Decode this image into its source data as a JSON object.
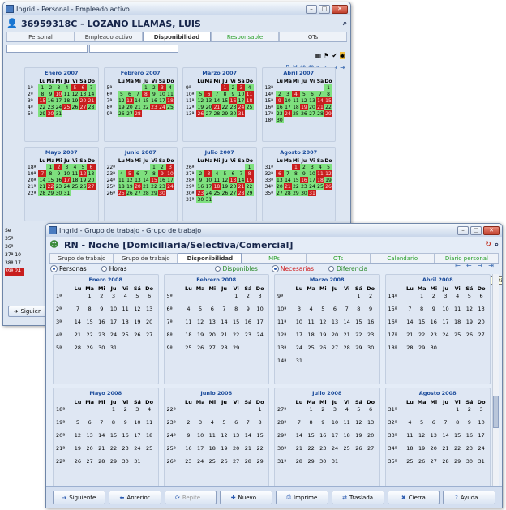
{
  "back": {
    "title": "Ingrid - Personal - Empleado activo",
    "header": "36959318C - LOZANO LLAMAS, LUIS",
    "tabs": [
      {
        "label": "Personal"
      },
      {
        "label": "Empleado activo"
      },
      {
        "label": "Disponibilidad"
      },
      {
        "label": "Responsable"
      },
      {
        "label": "OTs"
      }
    ],
    "side_weeks": [
      "Se",
      "35ª",
      "36ª",
      "37ª 10",
      "38ª 17",
      "39ª 24"
    ],
    "footer_btn": "Siguien",
    "months": [
      {
        "name": "Enero 2007",
        "rows": [
          [
            "1ª",
            "1",
            "2",
            "3",
            "4",
            "5",
            "6",
            "7"
          ],
          [
            "2ª",
            "8",
            "9",
            "10",
            "11",
            "12",
            "13",
            "14"
          ],
          [
            "3ª",
            "15",
            "16",
            "17",
            "18",
            "19",
            "20",
            "21"
          ],
          [
            "4ª",
            "22",
            "23",
            "24",
            "25",
            "26",
            "27",
            "28"
          ],
          [
            "5ª",
            "29",
            "30",
            "31",
            "",
            "",
            "",
            ""
          ]
        ]
      },
      {
        "name": "Febrero 2007",
        "rows": [
          [
            "5ª",
            "",
            "",
            "",
            "1",
            "2",
            "3",
            "4"
          ],
          [
            "6ª",
            "5",
            "6",
            "7",
            "8",
            "9",
            "10",
            "11"
          ],
          [
            "7ª",
            "12",
            "13",
            "14",
            "15",
            "16",
            "17",
            "18"
          ],
          [
            "8ª",
            "19",
            "20",
            "21",
            "22",
            "23",
            "24",
            "25"
          ],
          [
            "9ª",
            "26",
            "27",
            "28",
            "",
            "",
            "",
            ""
          ]
        ]
      },
      {
        "name": "Marzo 2007",
        "rows": [
          [
            "9ª",
            "",
            "",
            "",
            "1",
            "2",
            "3",
            "4"
          ],
          [
            "10ª",
            "5",
            "6",
            "7",
            "8",
            "9",
            "10",
            "11"
          ],
          [
            "11ª",
            "12",
            "13",
            "14",
            "15",
            "16",
            "17",
            "18"
          ],
          [
            "12ª",
            "19",
            "20",
            "21",
            "22",
            "23",
            "24",
            "25"
          ],
          [
            "13ª",
            "26",
            "27",
            "28",
            "29",
            "30",
            "31",
            ""
          ]
        ]
      },
      {
        "name": "Abril 2007",
        "rows": [
          [
            "13ª",
            "",
            "",
            "",
            "",
            "",
            "",
            "1"
          ],
          [
            "14ª",
            "2",
            "3",
            "4",
            "5",
            "6",
            "7",
            "8"
          ],
          [
            "15ª",
            "9",
            "10",
            "11",
            "12",
            "13",
            "14",
            "15"
          ],
          [
            "16ª",
            "16",
            "17",
            "18",
            "19",
            "20",
            "21",
            "22"
          ],
          [
            "17ª",
            "23",
            "24",
            "25",
            "26",
            "27",
            "28",
            "29"
          ],
          [
            "18ª",
            "30",
            "",
            "",
            "",
            "",
            "",
            ""
          ]
        ]
      },
      {
        "name": "Mayo 2007",
        "rows": [
          [
            "18ª",
            "",
            "1",
            "2",
            "3",
            "4",
            "5",
            "6"
          ],
          [
            "19ª",
            "7",
            "8",
            "9",
            "10",
            "11",
            "12",
            "13"
          ],
          [
            "20ª",
            "14",
            "15",
            "16",
            "17",
            "18",
            "19",
            "20"
          ],
          [
            "21ª",
            "21",
            "22",
            "23",
            "24",
            "25",
            "26",
            "27"
          ],
          [
            "22ª",
            "28",
            "29",
            "30",
            "31",
            "",
            "",
            ""
          ]
        ]
      },
      {
        "name": "Junio 2007",
        "rows": [
          [
            "22ª",
            "",
            "",
            "",
            "",
            "1",
            "2",
            "3"
          ],
          [
            "23ª",
            "4",
            "5",
            "6",
            "7",
            "8",
            "9",
            "10"
          ],
          [
            "24ª",
            "11",
            "12",
            "13",
            "14",
            "15",
            "16",
            "17"
          ],
          [
            "25ª",
            "18",
            "19",
            "20",
            "21",
            "22",
            "23",
            "24"
          ],
          [
            "26ª",
            "25",
            "26",
            "27",
            "28",
            "29",
            "30",
            ""
          ]
        ]
      },
      {
        "name": "Julio 2007",
        "rows": [
          [
            "26ª",
            "",
            "",
            "",
            "",
            "",
            "",
            "1"
          ],
          [
            "27ª",
            "2",
            "3",
            "4",
            "5",
            "6",
            "7",
            "8"
          ],
          [
            "28ª",
            "9",
            "10",
            "11",
            "12",
            "13",
            "14",
            "15"
          ],
          [
            "29ª",
            "16",
            "17",
            "18",
            "19",
            "20",
            "21",
            "22"
          ],
          [
            "30ª",
            "23",
            "24",
            "25",
            "26",
            "27",
            "28",
            "29"
          ],
          [
            "31ª",
            "30",
            "31",
            "",
            "",
            "",
            "",
            ""
          ]
        ]
      },
      {
        "name": "Agosto 2007",
        "rows": [
          [
            "31ª",
            "",
            "",
            "1",
            "2",
            "3",
            "4",
            "5"
          ],
          [
            "32ª",
            "6",
            "7",
            "8",
            "9",
            "10",
            "11",
            "12"
          ],
          [
            "33ª",
            "13",
            "14",
            "15",
            "16",
            "17",
            "18",
            "19"
          ],
          [
            "34ª",
            "20",
            "21",
            "22",
            "23",
            "24",
            "25",
            "26"
          ],
          [
            "35ª",
            "27",
            "28",
            "29",
            "30",
            "31",
            "",
            ""
          ]
        ]
      }
    ]
  },
  "front": {
    "title": "Ingrid - Grupo de trabajo - Grupo de trabajo",
    "header": "RN - Noche [Domiciliaria/Selectiva/Comercial]",
    "tabs": [
      {
        "label": "Grupo de trabajo"
      },
      {
        "label": "Grupo de trabajo"
      },
      {
        "label": "Disponibilidad"
      },
      {
        "label": "MPs"
      },
      {
        "label": "OTs"
      },
      {
        "label": "Calendario"
      },
      {
        "label": "Diario personal"
      }
    ],
    "options": [
      {
        "label": "Personas"
      },
      {
        "label": "Horas"
      },
      {
        "label": "Disponibles"
      },
      {
        "label": "Necesarias"
      },
      {
        "label": "Diferencia"
      }
    ],
    "tooltip": "Últir",
    "months": [
      {
        "name": "Enero 2008",
        "rows": [
          [
            "1ª",
            "",
            "1",
            "2",
            "3",
            "4",
            "5",
            "6"
          ],
          [
            "2ª",
            "7",
            "8",
            "9",
            "10",
            "11",
            "12",
            "13"
          ],
          [
            "3ª",
            "14",
            "15",
            "16",
            "17",
            "18",
            "19",
            "20"
          ],
          [
            "4ª",
            "21",
            "22",
            "23",
            "24",
            "25",
            "26",
            "27"
          ],
          [
            "5ª",
            "28",
            "29",
            "30",
            "31",
            "",
            "",
            ""
          ]
        ]
      },
      {
        "name": "Febrero 2008",
        "rows": [
          [
            "5ª",
            "",
            "",
            "",
            "",
            "1",
            "2",
            "3"
          ],
          [
            "6ª",
            "4",
            "5",
            "6",
            "7",
            "8",
            "9",
            "10"
          ],
          [
            "7ª",
            "11",
            "12",
            "13",
            "14",
            "15",
            "16",
            "17"
          ],
          [
            "8ª",
            "18",
            "19",
            "20",
            "21",
            "22",
            "23",
            "24"
          ],
          [
            "9ª",
            "25",
            "26",
            "27",
            "28",
            "29",
            "",
            ""
          ]
        ]
      },
      {
        "name": "Marzo 2008",
        "rows": [
          [
            "9ª",
            "",
            "",
            "",
            "",
            "",
            "1",
            "2"
          ],
          [
            "10ª",
            "3",
            "4",
            "5",
            "6",
            "7",
            "8",
            "9"
          ],
          [
            "11ª",
            "10",
            "11",
            "12",
            "13",
            "14",
            "15",
            "16"
          ],
          [
            "12ª",
            "17",
            "18",
            "19",
            "20",
            "21",
            "22",
            "23"
          ],
          [
            "13ª",
            "24",
            "25",
            "26",
            "27",
            "28",
            "29",
            "30"
          ],
          [
            "14ª",
            "31",
            "",
            "",
            "",
            "",
            "",
            ""
          ]
        ]
      },
      {
        "name": "Abril 2008",
        "rows": [
          [
            "14ª",
            "",
            "1",
            "2",
            "3",
            "4",
            "5",
            "6"
          ],
          [
            "15ª",
            "7",
            "8",
            "9",
            "10",
            "11",
            "12",
            "13"
          ],
          [
            "16ª",
            "14",
            "15",
            "16",
            "17",
            "18",
            "19",
            "20"
          ],
          [
            "17ª",
            "21",
            "22",
            "23",
            "24",
            "25",
            "26",
            "27"
          ],
          [
            "18ª",
            "28",
            "29",
            "30",
            "",
            "",
            "",
            ""
          ]
        ]
      },
      {
        "name": "Mayo 2008",
        "rows": [
          [
            "18ª",
            "",
            "",
            "",
            "1",
            "2",
            "3",
            "4"
          ],
          [
            "19ª",
            "5",
            "6",
            "7",
            "8",
            "9",
            "10",
            "11"
          ],
          [
            "20ª",
            "12",
            "13",
            "14",
            "15",
            "16",
            "17",
            "18"
          ],
          [
            "21ª",
            "19",
            "20",
            "21",
            "22",
            "23",
            "24",
            "25"
          ],
          [
            "22ª",
            "26",
            "27",
            "28",
            "29",
            "30",
            "31",
            ""
          ]
        ]
      },
      {
        "name": "Junio 2008",
        "rows": [
          [
            "22ª",
            "",
            "",
            "",
            "",
            "",
            "",
            "1"
          ],
          [
            "23ª",
            "2",
            "3",
            "4",
            "5",
            "6",
            "7",
            "8"
          ],
          [
            "24ª",
            "9",
            "10",
            "11",
            "12",
            "13",
            "14",
            "15"
          ],
          [
            "25ª",
            "16",
            "17",
            "18",
            "19",
            "20",
            "21",
            "22"
          ],
          [
            "26ª",
            "23",
            "24",
            "25",
            "26",
            "27",
            "28",
            "29"
          ]
        ]
      },
      {
        "name": "Julio 2008",
        "rows": [
          [
            "27ª",
            "",
            "1",
            "2",
            "3",
            "4",
            "5",
            "6"
          ],
          [
            "28ª",
            "7",
            "8",
            "9",
            "10",
            "11",
            "12",
            "13"
          ],
          [
            "29ª",
            "14",
            "15",
            "16",
            "17",
            "18",
            "19",
            "20"
          ],
          [
            "30ª",
            "21",
            "22",
            "23",
            "24",
            "25",
            "26",
            "27"
          ],
          [
            "31ª",
            "28",
            "29",
            "30",
            "31",
            "",
            "",
            ""
          ]
        ]
      },
      {
        "name": "Agosto 2008",
        "rows": [
          [
            "31ª",
            "",
            "",
            "",
            "",
            "1",
            "2",
            "3"
          ],
          [
            "32ª",
            "4",
            "5",
            "6",
            "7",
            "8",
            "9",
            "10"
          ],
          [
            "33ª",
            "11",
            "12",
            "13",
            "14",
            "15",
            "16",
            "17"
          ],
          [
            "34ª",
            "18",
            "19",
            "20",
            "21",
            "22",
            "23",
            "24"
          ],
          [
            "35ª",
            "25",
            "26",
            "27",
            "28",
            "29",
            "30",
            "31"
          ]
        ]
      }
    ],
    "buttons": [
      {
        "label": "Siguiente",
        "icon": "arrow-right"
      },
      {
        "label": "Anterior",
        "icon": "arrow-left"
      },
      {
        "label": "Repite...",
        "icon": "repeat"
      },
      {
        "label": "Nuevo...",
        "icon": "new"
      },
      {
        "label": "Imprime",
        "icon": "printer"
      },
      {
        "label": "Traslada",
        "icon": "move"
      },
      {
        "label": "Cierra",
        "icon": "close"
      },
      {
        "label": "Ayuda...",
        "icon": "help"
      }
    ]
  },
  "weekday_headers": [
    "Lu",
    "Ma",
    "Mi",
    "Ju",
    "Vi",
    "Sa",
    "Do"
  ],
  "weekday_headers_big": [
    "Lu",
    "Ma",
    "Mi",
    "Ju",
    "Vi",
    "Sá",
    "Do"
  ],
  "colors": {
    "available": "#7ee07e",
    "unavailable": "#c81e1e",
    "needed": "#d01c1c"
  }
}
